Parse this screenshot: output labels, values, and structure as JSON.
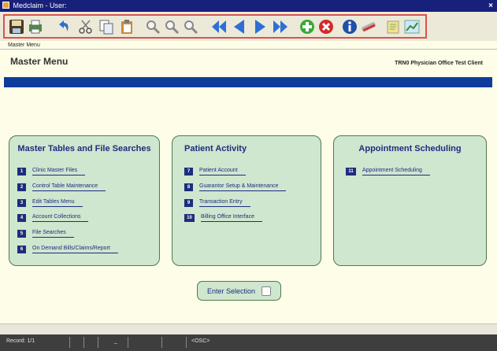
{
  "window": {
    "title": "Medclaim - User:",
    "close_glyph": "×"
  },
  "toolbar": {
    "icons": [
      "save-disk-icon",
      "print-icon",
      "undo-icon",
      "cut-icon",
      "copy-icon",
      "paste-icon",
      "find-icon",
      "find-next-icon",
      "find-previous-icon",
      "first-record-icon",
      "previous-record-icon",
      "next-record-icon",
      "last-record-icon",
      "add-icon",
      "delete-icon",
      "info-icon",
      "tools-icon",
      "notes-icon",
      "chart-icon"
    ]
  },
  "breadcrumb": "Master Menu",
  "header": {
    "title": "Master Menu",
    "client": "TRN0  Physician Office Test Client"
  },
  "panels": [
    {
      "title": "Master Tables and File Searches",
      "items": [
        {
          "num": "1",
          "label": "Clinic Master Files"
        },
        {
          "num": "2",
          "label": "Control Table Maintenance"
        },
        {
          "num": "3",
          "label": "Edit Tables Menu"
        },
        {
          "num": "4",
          "label": "Account Collections"
        },
        {
          "num": "5",
          "label": "File Searches"
        },
        {
          "num": "6",
          "label": "On Demand Bills/Claims/Report"
        }
      ]
    },
    {
      "title": "Patient Activity",
      "items": [
        {
          "num": "7",
          "label": "Patient Account"
        },
        {
          "num": "8",
          "label": "Guarantor Setup & Maintenance"
        },
        {
          "num": "9",
          "label": "Transaction Entry"
        },
        {
          "num": "10",
          "label": "Billing Office Interface"
        }
      ]
    },
    {
      "title": "Appointment Scheduling",
      "items": [
        {
          "num": "11",
          "label": "Appointment Scheduling"
        }
      ]
    }
  ],
  "enter_selection": {
    "label": "Enter Selection"
  },
  "status": {
    "record": "Record: 1/1",
    "osc": "<OSC>",
    "mark": "_"
  },
  "colors": {
    "titlebar": "#17207a",
    "accent_blue": "#0d3c9a",
    "panel_green": "#cfe6cf",
    "label_blue": "#1d2d7d",
    "toolbar_highlight": "#d9534f"
  }
}
